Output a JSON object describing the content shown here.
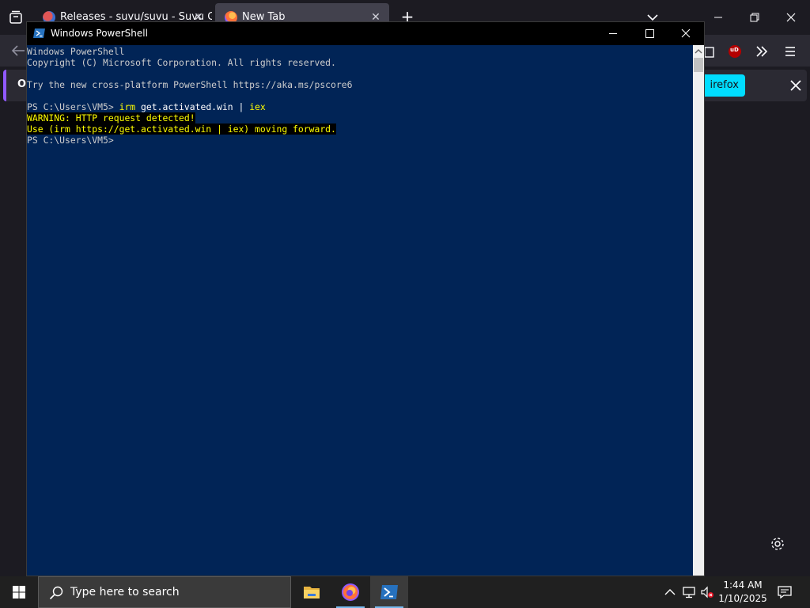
{
  "browser": {
    "tabs": [
      {
        "title": "Releases - suvu/suvu - Suvu Git",
        "active": false
      },
      {
        "title": "New Tab",
        "active": true
      }
    ],
    "new_tab_symbol": "+",
    "notification": {
      "text": "Op",
      "button_label": "irefox"
    },
    "accent_color": "#9059ff",
    "button_color": "#00ddff",
    "extension_badge": "uD"
  },
  "powershell": {
    "window_title": "Windows PowerShell",
    "background_color": "#012456",
    "lines": {
      "l1": "Windows PowerShell",
      "l2": "Copyright (C) Microsoft Corporation. All rights reserved.",
      "l3": "",
      "l4": "Try the new cross-platform PowerShell https://aka.ms/pscore6",
      "l5": "",
      "l6_prompt": "PS C:\\Users\\VM5> ",
      "l6_cmd_a": "irm",
      "l6_cmd_b": " get.activated.win | ",
      "l6_cmd_c": "iex",
      "l7": "WARNING: HTTP request detected!",
      "l8": "Use (irm https://get.activated.win | iex) moving forward.",
      "l9": "PS C:\\Users\\VM5>"
    }
  },
  "taskbar": {
    "search_placeholder": "Type here to search",
    "apps": [
      "file-explorer",
      "firefox",
      "powershell"
    ],
    "clock": {
      "time": "1:44 AM",
      "date": "1/10/2025"
    },
    "accent_color": "#76b9ed"
  }
}
